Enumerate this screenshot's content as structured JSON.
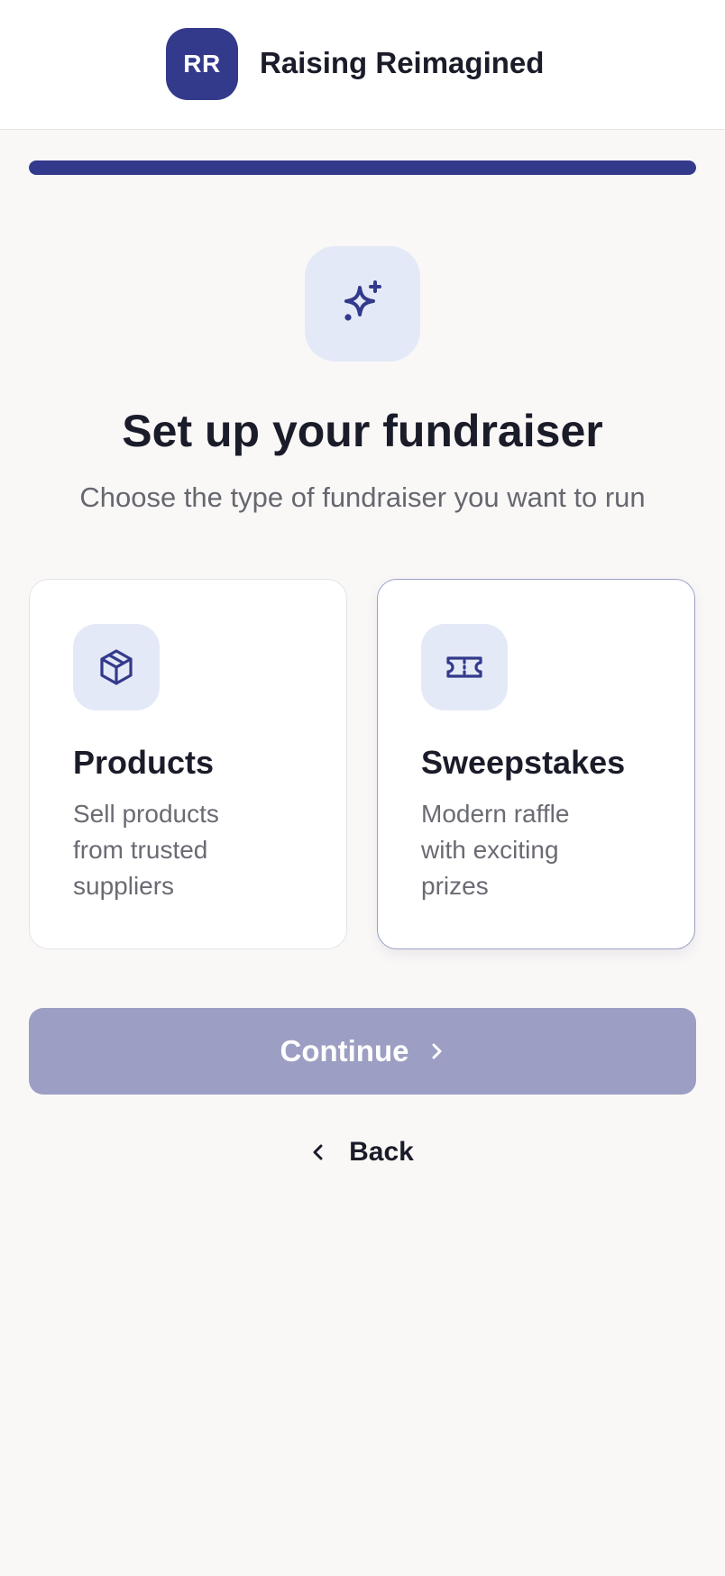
{
  "header": {
    "logo_initials": "RR",
    "brand_name": "Raising Reimagined"
  },
  "progress": {
    "fraction": 1.0
  },
  "hero": {
    "icon": "sparkles-icon",
    "title": "Set up your fundraiser",
    "subtitle": "Choose the type of fundraiser you want to run"
  },
  "options": [
    {
      "icon": "package-box-icon",
      "title": "Products",
      "description": "Sell products from trusted suppliers",
      "selected": false
    },
    {
      "icon": "ticket-icon",
      "title": "Sweepstakes",
      "description": "Modern raffle with exciting prizes",
      "selected": false
    }
  ],
  "actions": {
    "continue_label": "Continue",
    "back_label": "Back"
  },
  "colors": {
    "brand": "#333a8c",
    "icon_tile_bg": "#e4e9f7",
    "button_disabled": "#9c9fc3",
    "page_bg": "#faf8f7"
  }
}
